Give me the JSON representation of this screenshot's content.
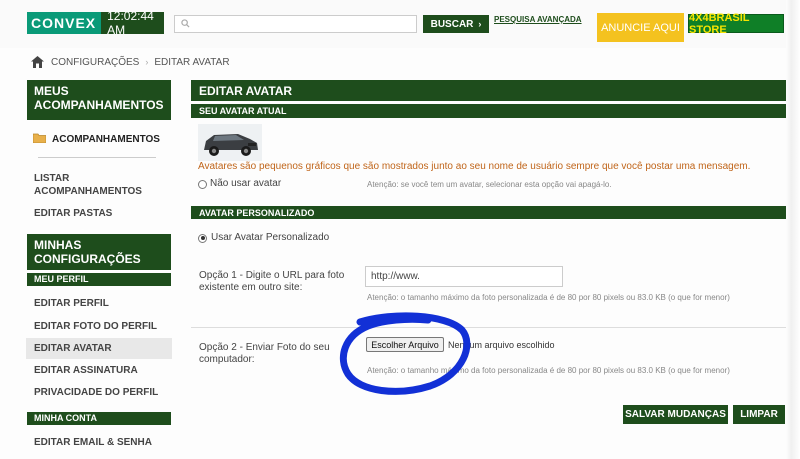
{
  "header": {
    "brand": "CONVEX",
    "clock": "12:02:44 AM",
    "search_placeholder": "",
    "search_button": "BUSCAR",
    "advanced_search": "PESQUISA AVANÇADA",
    "ad_label": "ANUNCIE AQUI",
    "brand_4x4": "4X4BRASIL STORE"
  },
  "breadcrumb": {
    "items": [
      "CONFIGURAÇÕES",
      "EDITAR AVATAR"
    ]
  },
  "sidebar": {
    "section1_title": "MEUS ACOMPANHAMENTOS",
    "folder_item": "ACOMPANHAMENTOS",
    "list_item": "LISTAR ACOMPANHAMENTOS",
    "edit_folders": "EDITAR PASTAS",
    "section2_title": "MINHAS CONFIGURAÇÕES",
    "profile_sub": "MEU PERFIL",
    "profile_items": [
      "EDITAR PERFIL",
      "EDITAR FOTO DO PERFIL",
      "EDITAR AVATAR",
      "EDITAR ASSINATURA",
      "PRIVACIDADE DO PERFIL"
    ],
    "account_sub": "MINHA CONTA",
    "account_items": [
      "EDITAR EMAIL & SENHA"
    ]
  },
  "main": {
    "title": "EDITAR AVATAR",
    "current_section": "SEU AVATAR ATUAL",
    "avatar_desc": "Avatares são pequenos gráficos que são mostrados junto ao seu nome de usuário sempre que você postar uma mensagem.",
    "no_avatar_label": "Não usar avatar",
    "no_avatar_note": "Atenção: se você tem um avatar, selecionar esta opção vai apagá-lo.",
    "custom_section": "AVATAR PERSONALIZADO",
    "use_custom_label": "Usar Avatar Personalizado",
    "option1_label": "Opção 1 - Digite o URL para foto existente em outro site:",
    "url_value": "http://www.",
    "option1_note": "Atenção: o tamanho máximo da foto personalizada é de 80 por 80 pixels ou 83.0 KB (o que for menor)",
    "option2_label": "Opção 2 - Enviar Foto do seu computador:",
    "choose_file_button": "Escolher Arquivo",
    "no_file_text": "Nenhum arquivo escolhido",
    "option2_note": "Atenção: o tamanho máximo da foto personalizada é de 80 por 80 pixels ou 83.0 KB (o que for menor)",
    "save_button": "SALVAR MUDANÇAS",
    "clear_button": "LIMPAR"
  },
  "colors": {
    "dark_green": "#1e4d1c",
    "teal": "#0a9a78",
    "ad_yellow": "#f4c21f",
    "desc_orange": "#c0651a",
    "annotation_blue": "#1230d6"
  },
  "icons": [
    "search-icon",
    "chevron-right-icon",
    "home-icon",
    "folder-icon"
  ]
}
